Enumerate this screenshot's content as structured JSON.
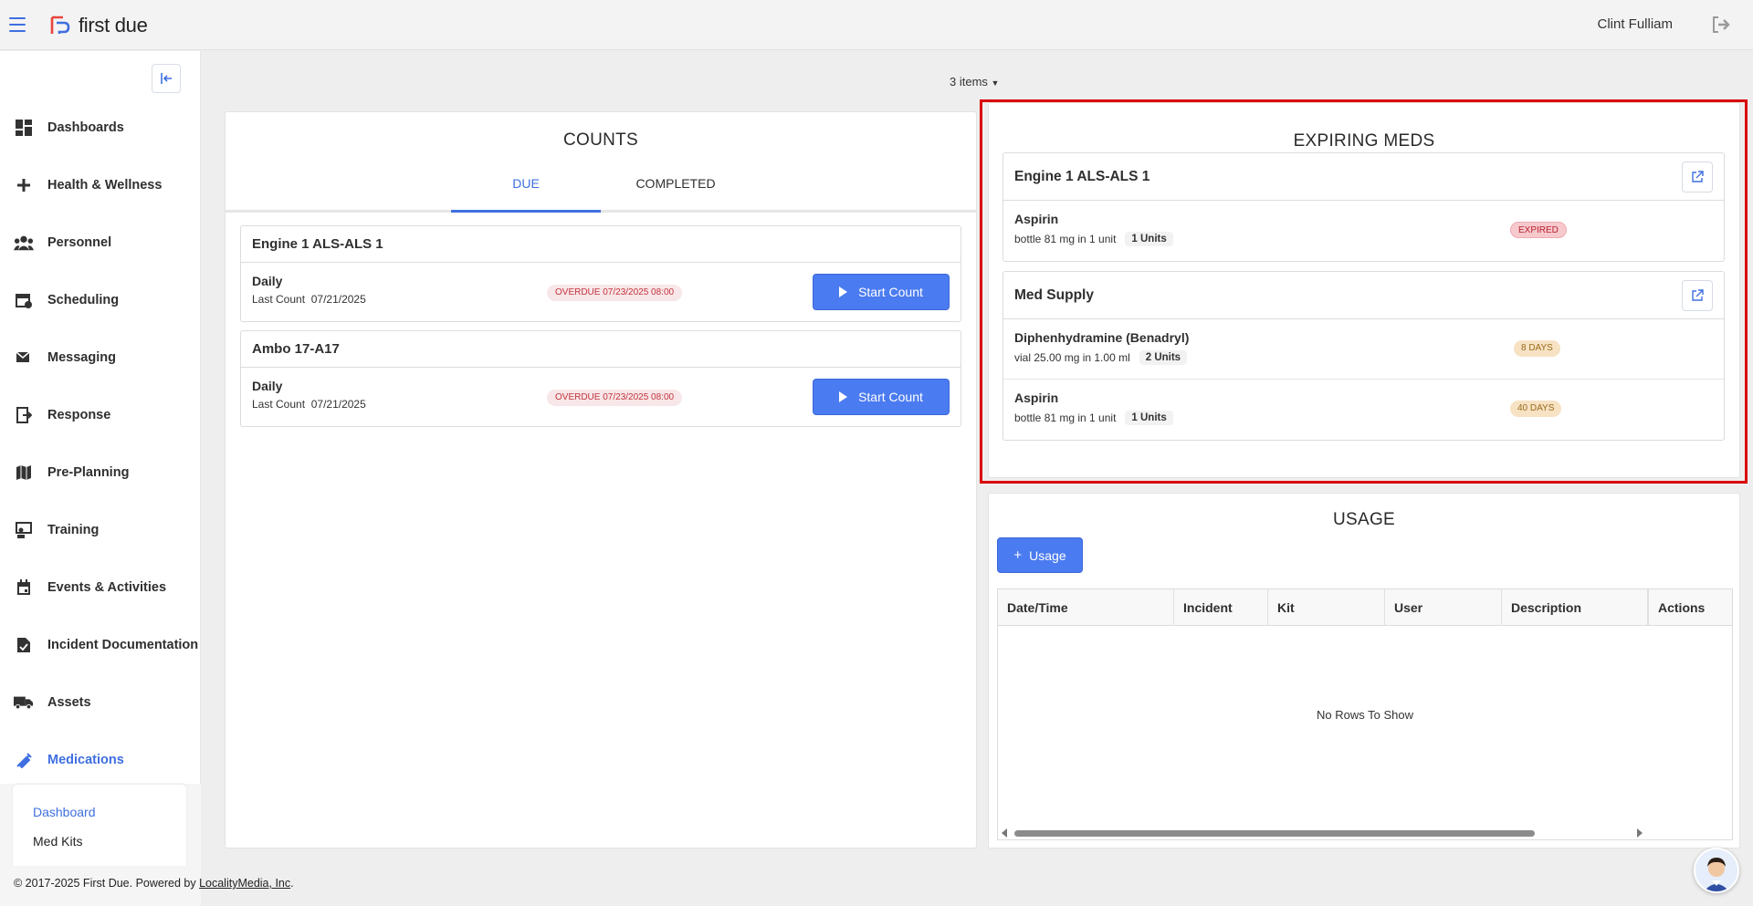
{
  "topbar": {
    "logo_text": "first due",
    "user_name": "Clint Fulliam"
  },
  "sidebar": {
    "items": [
      {
        "label": "Dashboards",
        "icon": "dashboard-icon"
      },
      {
        "label": "Health & Wellness",
        "icon": "plus-icon"
      },
      {
        "label": "Personnel",
        "icon": "people-icon"
      },
      {
        "label": "Scheduling",
        "icon": "calendar-clock-icon"
      },
      {
        "label": "Messaging",
        "icon": "mail-icon"
      },
      {
        "label": "Response",
        "icon": "response-icon"
      },
      {
        "label": "Pre-Planning",
        "icon": "map-icon"
      },
      {
        "label": "Training",
        "icon": "training-icon"
      },
      {
        "label": "Events & Activities",
        "icon": "calendar-icon"
      },
      {
        "label": "Incident Documentation",
        "icon": "document-icon"
      },
      {
        "label": "Assets",
        "icon": "truck-icon"
      },
      {
        "label": "Medications",
        "icon": "syringe-icon",
        "active": true
      }
    ],
    "subitems": [
      {
        "label": "Dashboard",
        "active": true
      },
      {
        "label": "Med Kits"
      }
    ]
  },
  "items_count": "3 items",
  "counts": {
    "title": "COUNTS",
    "tabs": {
      "due": "DUE",
      "completed": "COMPLETED"
    },
    "kits": [
      {
        "name": "Engine 1 ALS-ALS 1",
        "frequency": "Daily",
        "last_count_label": "Last Count",
        "last_count": "07/21/2025",
        "status": "OVERDUE 07/23/2025 08:00",
        "button": "Start Count"
      },
      {
        "name": "Ambo 17-A17",
        "frequency": "Daily",
        "last_count_label": "Last Count",
        "last_count": "07/21/2025",
        "status": "OVERDUE 07/23/2025 08:00",
        "button": "Start Count"
      }
    ]
  },
  "expiring": {
    "title": "EXPIRING MEDS",
    "groups": [
      {
        "name": "Engine 1 ALS-ALS 1",
        "meds": [
          {
            "name": "Aspirin",
            "detail": "bottle 81 mg in 1 unit",
            "units": "1 Units",
            "badge": "EXPIRED"
          }
        ]
      },
      {
        "name": "Med Supply",
        "meds": [
          {
            "name": "Diphenhydramine (Benadryl)",
            "detail": "vial 25.00 mg in 1.00 ml",
            "units": "2 Units",
            "badge": "8 DAYS"
          },
          {
            "name": "Aspirin",
            "detail": "bottle 81 mg in 1 unit",
            "units": "1 Units",
            "badge": "40 DAYS"
          }
        ]
      }
    ]
  },
  "usage": {
    "title": "USAGE",
    "button": "Usage",
    "columns": [
      "Date/Time",
      "Incident",
      "Kit",
      "User",
      "Description",
      "Actions"
    ],
    "empty_text": "No Rows To Show"
  },
  "footer": {
    "copyright": "© 2017-2025 First Due. Powered by ",
    "link": "LocalityMedia, Inc",
    "suffix": "."
  },
  "colors": {
    "accent": "#3f6fe0",
    "button": "#4b7bf0",
    "highlight": "#d90000",
    "overdue": "#c3323d"
  }
}
